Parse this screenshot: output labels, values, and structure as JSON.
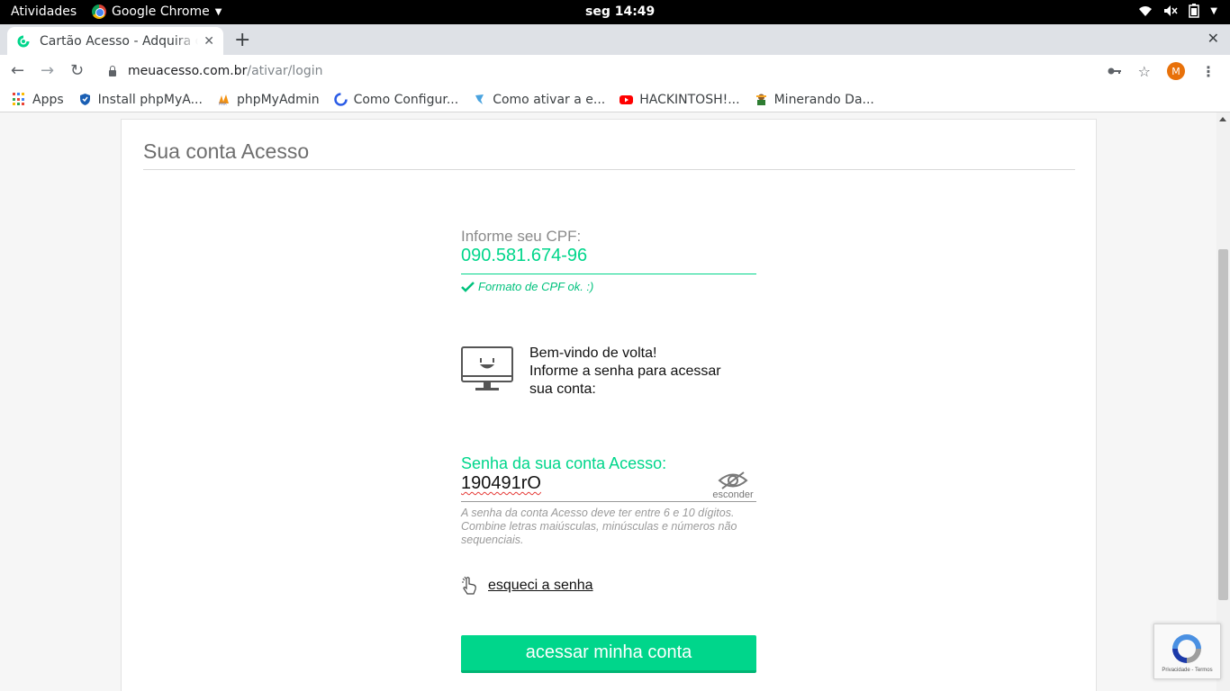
{
  "system_bar": {
    "activities": "Atividades",
    "app_name": "Google Chrome",
    "clock": "seg 14:49"
  },
  "browser": {
    "tab_title": "Cartão Acesso - Adquira o",
    "url_host": "meuacesso.com.br",
    "url_path": "/ativar/login",
    "profile_initial": "M",
    "bookmarks": [
      {
        "label": "Apps",
        "icon": "apps-grid-icon"
      },
      {
        "label": "Install phpMyA...",
        "icon": "shield-icon"
      },
      {
        "label": "phpMyAdmin",
        "icon": "phpmyadmin-icon"
      },
      {
        "label": "Como Configur...",
        "icon": "blue-logo-icon"
      },
      {
        "label": "Como ativar a e...",
        "icon": "bird-icon"
      },
      {
        "label": "HACKINTOSH!...",
        "icon": "youtube-icon"
      },
      {
        "label": "Minerando Da...",
        "icon": "miner-icon"
      }
    ]
  },
  "page": {
    "card_title": "Sua conta Acesso",
    "cpf_label": "Informe seu CPF:",
    "cpf_value": "090.581.674-96",
    "cpf_ok": "Formato de CPF ok. :)",
    "welcome_line1": "Bem-vindo de volta!",
    "welcome_line2": "Informe a senha para acessar",
    "welcome_line3": "sua conta:",
    "password_label": "Senha da sua conta Acesso:",
    "password_value": "190491rO",
    "toggle_label": "esconder",
    "password_hint": "A senha da conta Acesso deve ter entre 6 e 10 dígitos. Combine letras maiúsculas, minúsculas e números não sequenciais.",
    "forgot_label": "esqueci a senha",
    "submit_label": "acessar minha conta"
  },
  "recaptcha": {
    "footer": "Privacidade - Termos"
  },
  "colors": {
    "accent": "#00d68b",
    "error_underline": "#e53935"
  }
}
